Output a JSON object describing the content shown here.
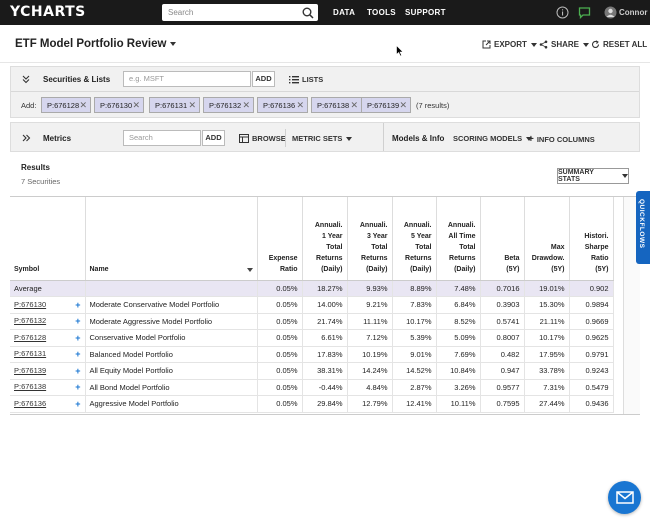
{
  "nav": {
    "logo": "YCHARTS",
    "search_placeholder": "Search",
    "links": [
      "DATA",
      "TOOLS",
      "SUPPORT"
    ],
    "user": "Connor"
  },
  "title_bar": {
    "title": "ETF Model Portfolio Review",
    "export": "EXPORT",
    "share": "SHARE",
    "reset": "RESET ALL"
  },
  "securities": {
    "label": "Securities & Lists",
    "input_placeholder": "e.g. MSFT",
    "add_label": "ADD",
    "lists_label": "LISTS",
    "add_prefix": "Add:",
    "chips": [
      "P:676128",
      "P:676130",
      "P:676131",
      "P:676132",
      "P:676136",
      "P:676138",
      "P:676139"
    ],
    "count": "(7 results)"
  },
  "metrics": {
    "label": "Metrics",
    "input_placeholder": "Search",
    "add_label": "ADD",
    "browse": "BROWSE",
    "metric_sets": "METRIC SETS",
    "models_info": "Models & Info",
    "scoring_models": "SCORING MODELS",
    "info_columns": "INFO COLUMNS"
  },
  "results": {
    "title": "Results",
    "subtitle": "7 Securities",
    "summary_button": "SUMMARY STATS"
  },
  "table": {
    "headers": [
      [
        "Symbol"
      ],
      [
        "Name"
      ],
      [
        "Expense",
        "Ratio"
      ],
      [
        "Annuali.",
        "1 Year",
        "Total",
        "Returns",
        "(Daily)"
      ],
      [
        "Annuali.",
        "3 Year",
        "Total",
        "Returns",
        "(Daily)"
      ],
      [
        "Annuali.",
        "5 Year",
        "Total",
        "Returns",
        "(Daily)"
      ],
      [
        "Annuali.",
        "All Time",
        "Total",
        "Returns",
        "(Daily)"
      ],
      [
        "Beta",
        "(5Y)"
      ],
      [
        "Max",
        "Drawdow.",
        "(5Y)"
      ],
      [
        "Histori.",
        "Sharpe",
        "Ratio",
        "(5Y)"
      ]
    ],
    "average": {
      "label": "Average",
      "values": [
        "0.05%",
        "18.27%",
        "9.93%",
        "8.89%",
        "7.48%",
        "0.7016",
        "19.01%",
        "0.902"
      ]
    },
    "rows": [
      {
        "symbol": "P:676130",
        "name": "Moderate Conservative Model Portfolio",
        "values": [
          "0.05%",
          "14.00%",
          "9.21%",
          "7.83%",
          "6.84%",
          "0.3903",
          "15.30%",
          "0.9894"
        ]
      },
      {
        "symbol": "P:676132",
        "name": "Moderate Aggressive Model Portfolio",
        "values": [
          "0.05%",
          "21.74%",
          "11.11%",
          "10.17%",
          "8.52%",
          "0.5741",
          "21.11%",
          "0.9669"
        ]
      },
      {
        "symbol": "P:676128",
        "name": "Conservative Model Portfolio",
        "values": [
          "0.05%",
          "6.61%",
          "7.12%",
          "5.39%",
          "5.09%",
          "0.8007",
          "10.17%",
          "0.9625"
        ]
      },
      {
        "symbol": "P:676131",
        "name": "Balanced Model Portfolio",
        "values": [
          "0.05%",
          "17.83%",
          "10.19%",
          "9.01%",
          "7.69%",
          "0.482",
          "17.95%",
          "0.9791"
        ]
      },
      {
        "symbol": "P:676139",
        "name": "All Equity Model Portfolio",
        "values": [
          "0.05%",
          "38.31%",
          "14.24%",
          "14.52%",
          "10.84%",
          "0.947",
          "33.78%",
          "0.9243"
        ]
      },
      {
        "symbol": "P:676138",
        "name": "All Bond Model Portfolio",
        "values": [
          "0.05%",
          "-0.44%",
          "4.84%",
          "2.87%",
          "3.26%",
          "0.9577",
          "7.31%",
          "0.5479"
        ]
      },
      {
        "symbol": "P:676136",
        "name": "Aggressive Model Portfolio",
        "values": [
          "0.05%",
          "29.84%",
          "12.79%",
          "12.41%",
          "10.11%",
          "0.7595",
          "27.44%",
          "0.9436"
        ]
      }
    ]
  },
  "quickflows": "QUICKFLOWS",
  "colors": {
    "nav_bg": "#1a1a1a",
    "accent_blue": "#1976d2",
    "chip_bg": "#d6d6ee",
    "average_row_bg": "#e9e6f3",
    "chat_icon_green": "#4caf50"
  },
  "icons": [
    "search-icon",
    "info-icon",
    "chat-icon",
    "user-icon",
    "export-icon",
    "share-icon",
    "reset-icon",
    "double-chevron-down-icon",
    "double-chevron-right-icon",
    "list-icon",
    "browse-icon",
    "plus-icon",
    "mail-icon"
  ]
}
